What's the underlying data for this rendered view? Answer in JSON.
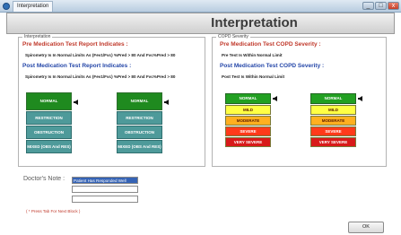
{
  "window": {
    "tab_label": "Interpretation",
    "min": "_",
    "max": "□",
    "close": "x"
  },
  "header": {
    "title": "Interpretation"
  },
  "interpretation": {
    "legend": "Interpretation",
    "pre_title": "Pre Medication Test Report Indicates :",
    "pre_text": "Spirometry Is In Normal Limits As (Fev1/Fvc) %Pred > 80 And Fvc%Pred > 80",
    "post_title": "Post Medication Test Report Indicates :",
    "post_text": "Spirometry Is In Normal Limits As (Fev1/Fvc) %Pred > 80 And Fvc%Pred > 80",
    "scale": [
      "NORMAL",
      "RESTRICTION",
      "OBSTRUCTION",
      "MIXED (OBS And RES)"
    ],
    "pre_selected": "NORMAL",
    "post_selected": "NORMAL"
  },
  "copd": {
    "legend": "COPD Severity",
    "pre_title": "Pre Medication Test COPD Severity :",
    "pre_text": "Pre Test Is Within Normal Limit",
    "post_title": "Post Medication Test COPD Severity :",
    "post_text": "Post Test Is Within Normal Limit",
    "scale": [
      "NORMAL",
      "MILD",
      "MODERATE",
      "SEVERE",
      "VERY SEVERE"
    ],
    "pre_selected": "NORMAL",
    "post_selected": "NORMAL"
  },
  "note": {
    "label": "Doctor's Note :",
    "line1": "Patient Has Responded Well",
    "line2": "",
    "line3": "",
    "hint": "( * Press Tab For Next Block )"
  },
  "ok_label": "OK"
}
